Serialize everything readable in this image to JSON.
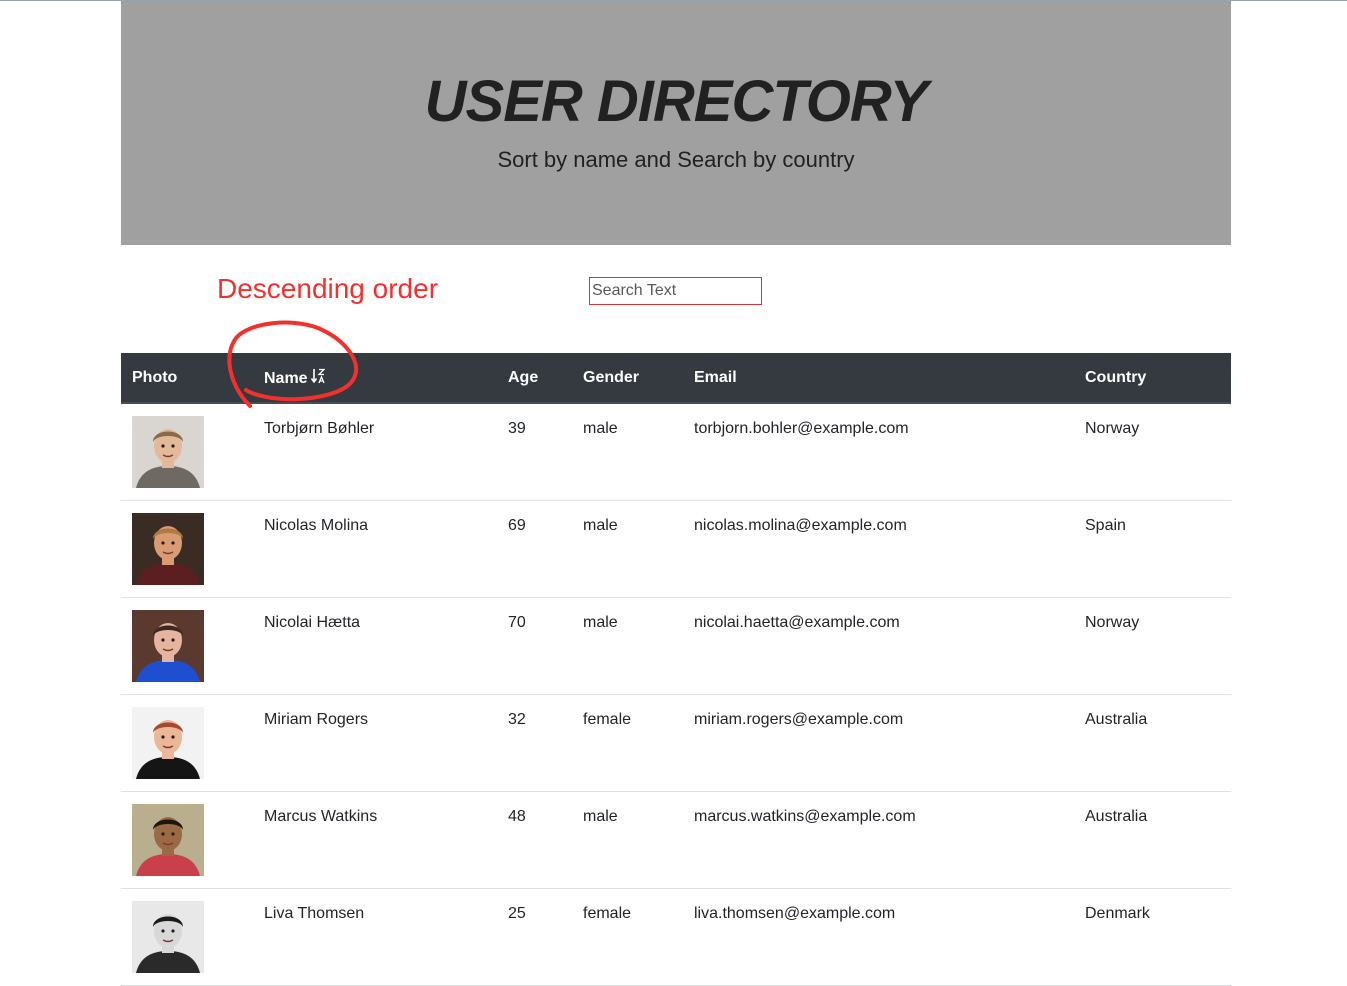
{
  "header": {
    "title": "USER DIRECTORY",
    "subtitle": "Sort by name and Search by country"
  },
  "annotation": {
    "text": "Descending order",
    "color": "#f2312f"
  },
  "search": {
    "placeholder": "Search Text",
    "value": ""
  },
  "table": {
    "columns": [
      "Photo",
      "Name",
      "Age",
      "Gender",
      "Email",
      "Country"
    ],
    "sort": {
      "column": "Name",
      "direction": "descending",
      "icon": "sort-alpha-down-alt-icon"
    },
    "rows": [
      {
        "name": "Torbjørn Bøhler",
        "age": "39",
        "gender": "male",
        "email": "torbjorn.bohler@example.com",
        "country": "Norway",
        "avatar": {
          "bg": "#d9d6d2",
          "skin": "#e2b99a",
          "hair": "#8a6a4a",
          "shirt": "#6e6a63"
        }
      },
      {
        "name": "Nicolas Molina",
        "age": "69",
        "gender": "male",
        "email": "nicolas.molina@example.com",
        "country": "Spain",
        "avatar": {
          "bg": "#3a2b24",
          "skin": "#d89b74",
          "hair": "#b07a3e",
          "shirt": "#5b1f22"
        }
      },
      {
        "name": "Nicolai Hætta",
        "age": "70",
        "gender": "male",
        "email": "nicolai.haetta@example.com",
        "country": "Norway",
        "avatar": {
          "bg": "#5a3a2e",
          "skin": "#e6b5a0",
          "hair": "#3a2a22",
          "shirt": "#1e4fd0"
        }
      },
      {
        "name": "Miriam Rogers",
        "age": "32",
        "gender": "female",
        "email": "miriam.rogers@example.com",
        "country": "Australia",
        "avatar": {
          "bg": "#f2f2f2",
          "skin": "#eab79a",
          "hair": "#a8482e",
          "shirt": "#151515"
        }
      },
      {
        "name": "Marcus Watkins",
        "age": "48",
        "gender": "male",
        "email": "marcus.watkins@example.com",
        "country": "Australia",
        "avatar": {
          "bg": "#b9ae8e",
          "skin": "#9a6a45",
          "hair": "#1c1612",
          "shirt": "#c9404c"
        }
      },
      {
        "name": "Liva Thomsen",
        "age": "25",
        "gender": "female",
        "email": "liva.thomsen@example.com",
        "country": "Denmark",
        "avatar": {
          "bg": "#e8e8e8",
          "skin": "#d8d8d8",
          "hair": "#1a1a1a",
          "shirt": "#2a2a2a"
        }
      }
    ]
  }
}
